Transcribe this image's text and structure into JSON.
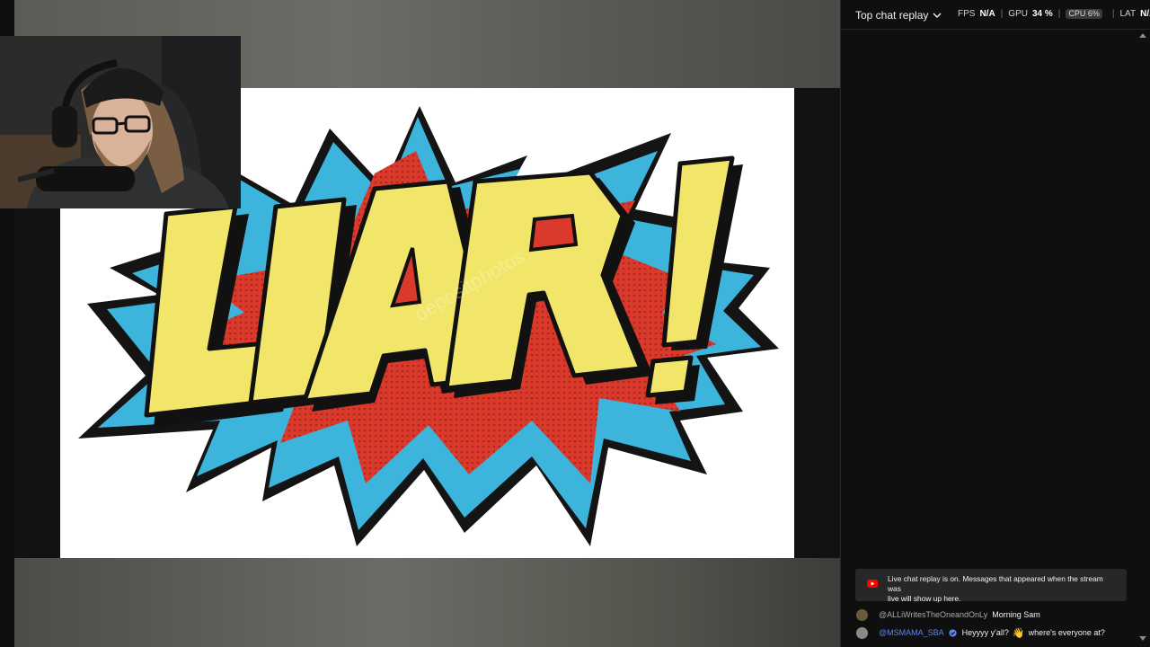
{
  "chat": {
    "title": "Top chat replay",
    "stats": {
      "fps_label": "FPS",
      "fps_value": "N/A",
      "gpu_label": "GPU",
      "gpu_value": "34 %",
      "cpu_pill": "CPU 6%",
      "cpu_value": "",
      "lat_label": "LAT",
      "lat_value": "N/A"
    },
    "notice": {
      "line1": "Live chat replay is on. Messages that appeared when the stream was",
      "line2": "live will show up here."
    },
    "messages": [
      {
        "author": "@ALLiWritesTheOneandOnLy",
        "text": "Morning Sam",
        "avatar_color": "#6b5a3a"
      },
      {
        "author": "@MSMAMA_SBA",
        "text_before": "Heyyyy y'all?",
        "emoji": "👋",
        "text_after": "where's everyone at?",
        "avatar_color": "#8a8a84",
        "verified": true
      }
    ]
  },
  "video": {
    "slide_text": "LIAR!",
    "accent_colors": {
      "yellow": "#f2e66a",
      "blue": "#3cb4dc",
      "red": "#d93a2b",
      "outline": "#111111"
    }
  },
  "icons": {
    "chevron": "chevron-down-icon",
    "youtube": "youtube-icon",
    "verified": "verified-badge-icon"
  }
}
